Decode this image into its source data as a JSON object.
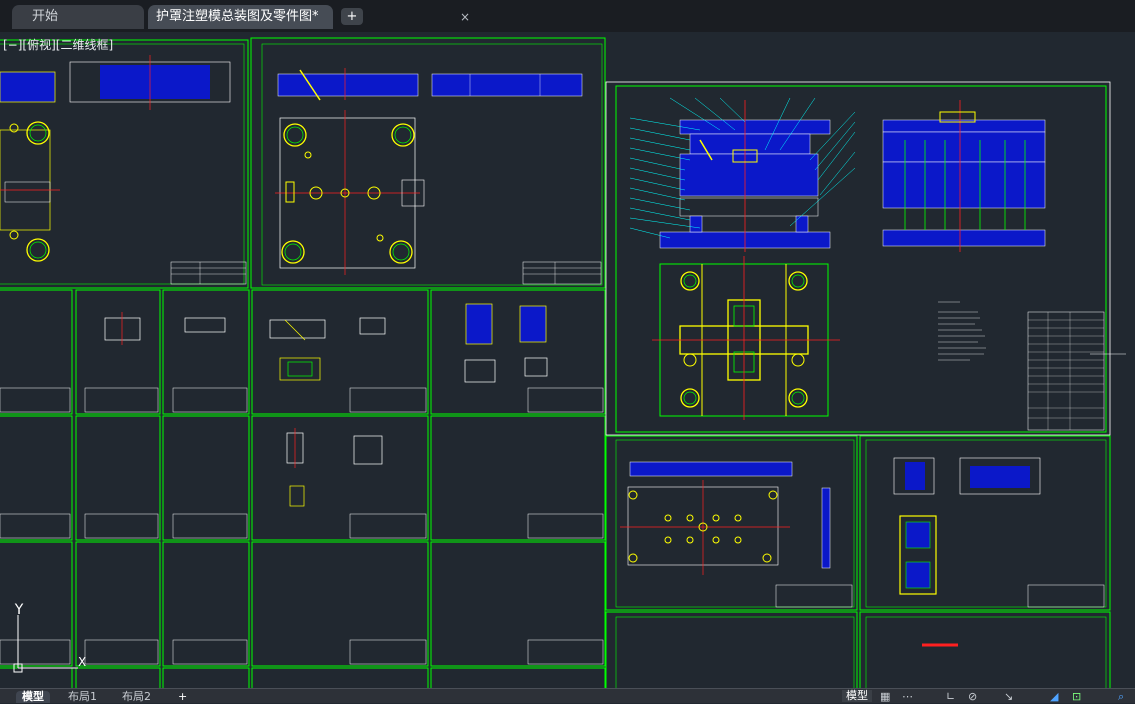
{
  "tabs": {
    "start_label": "开始",
    "document_label": "护罩注塑模总装图及零件图*",
    "close_glyph": "×",
    "new_tab_glyph": "+"
  },
  "viewport": {
    "label": "[−][俯视][二维线框]"
  },
  "ucs": {
    "y_label": "Y",
    "x_label": "X"
  },
  "layout_tabs": {
    "model": "模型",
    "layout1": "布局1",
    "layout2": "布局2",
    "add": "+"
  },
  "status_bar": {
    "model": "模型",
    "grid_icon": "grid-icon",
    "snap_icon": "snap-icon",
    "ortho_icon": "ortho-icon",
    "polar_icon": "polar-icon",
    "osnap_icon": "osnap-icon"
  },
  "colors": {
    "background": "#212830",
    "frame": "#00ff00",
    "part_fill": "#0b18c9",
    "centerline": "#ff2020",
    "outline": "#ffff00",
    "text": "#ffffff"
  }
}
